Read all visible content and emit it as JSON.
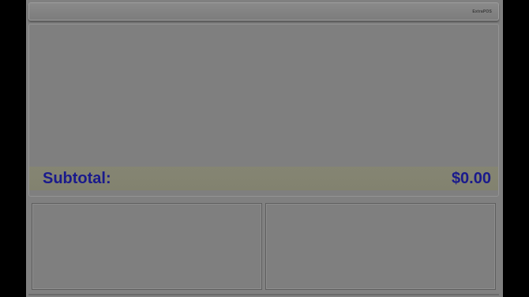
{
  "header": {
    "brand": {
      "text": "ExtraPOS",
      "icon": "brand-logo"
    }
  },
  "order": {
    "items": [],
    "subtotal_label": "Subtotal:",
    "subtotal_value": "$0.00"
  },
  "colors": {
    "screen_background": "#808080",
    "subtotal_text": "#1a1a8c",
    "subtotal_bar": "#848471",
    "outer_background": "#000000"
  }
}
